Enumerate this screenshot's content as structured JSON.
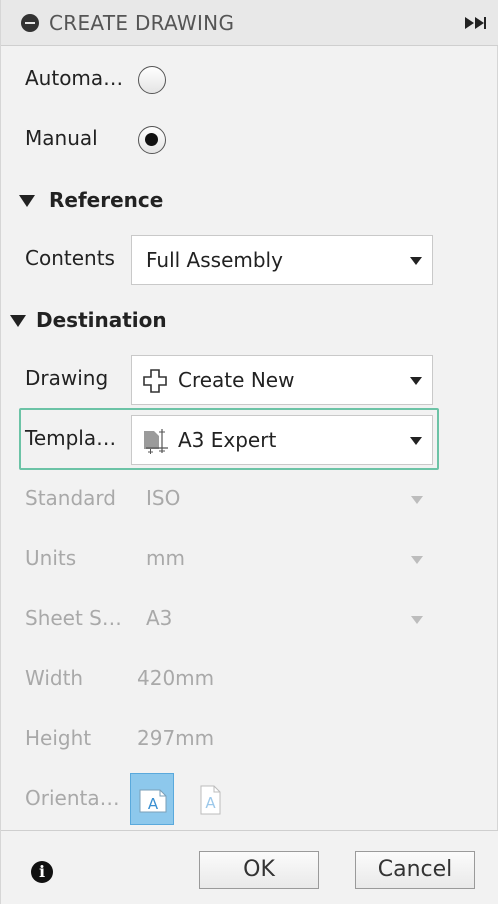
{
  "header": {
    "title": "CREATE DRAWING"
  },
  "mode": {
    "automatic_label": "Automa…",
    "manual_label": "Manual",
    "selected": "Manual"
  },
  "reference": {
    "section_label": "Reference",
    "contents_label": "Contents",
    "contents_value": "Full Assembly"
  },
  "destination": {
    "section_label": "Destination",
    "drawing_label": "Drawing",
    "drawing_value": "Create New",
    "template_label": "Templa…",
    "template_value": "A3 Expert",
    "standard_label": "Standard",
    "standard_value": "ISO",
    "units_label": "Units",
    "units_value": "mm",
    "sheet_size_label": "Sheet S…",
    "sheet_size_value": "A3",
    "width_label": "Width",
    "width_value": "420mm",
    "height_label": "Height",
    "height_value": "297mm",
    "orientation_label": "Orienta…",
    "orientation_selected": "landscape",
    "orientation_icon_letter": "A"
  },
  "footer": {
    "info_glyph": "i",
    "ok_label": "OK",
    "cancel_label": "Cancel"
  },
  "colors": {
    "highlight_border": "#6cc3a6",
    "active_orientation_bg": "#8dc8ec",
    "disabled_text": "#a9a9a9"
  }
}
